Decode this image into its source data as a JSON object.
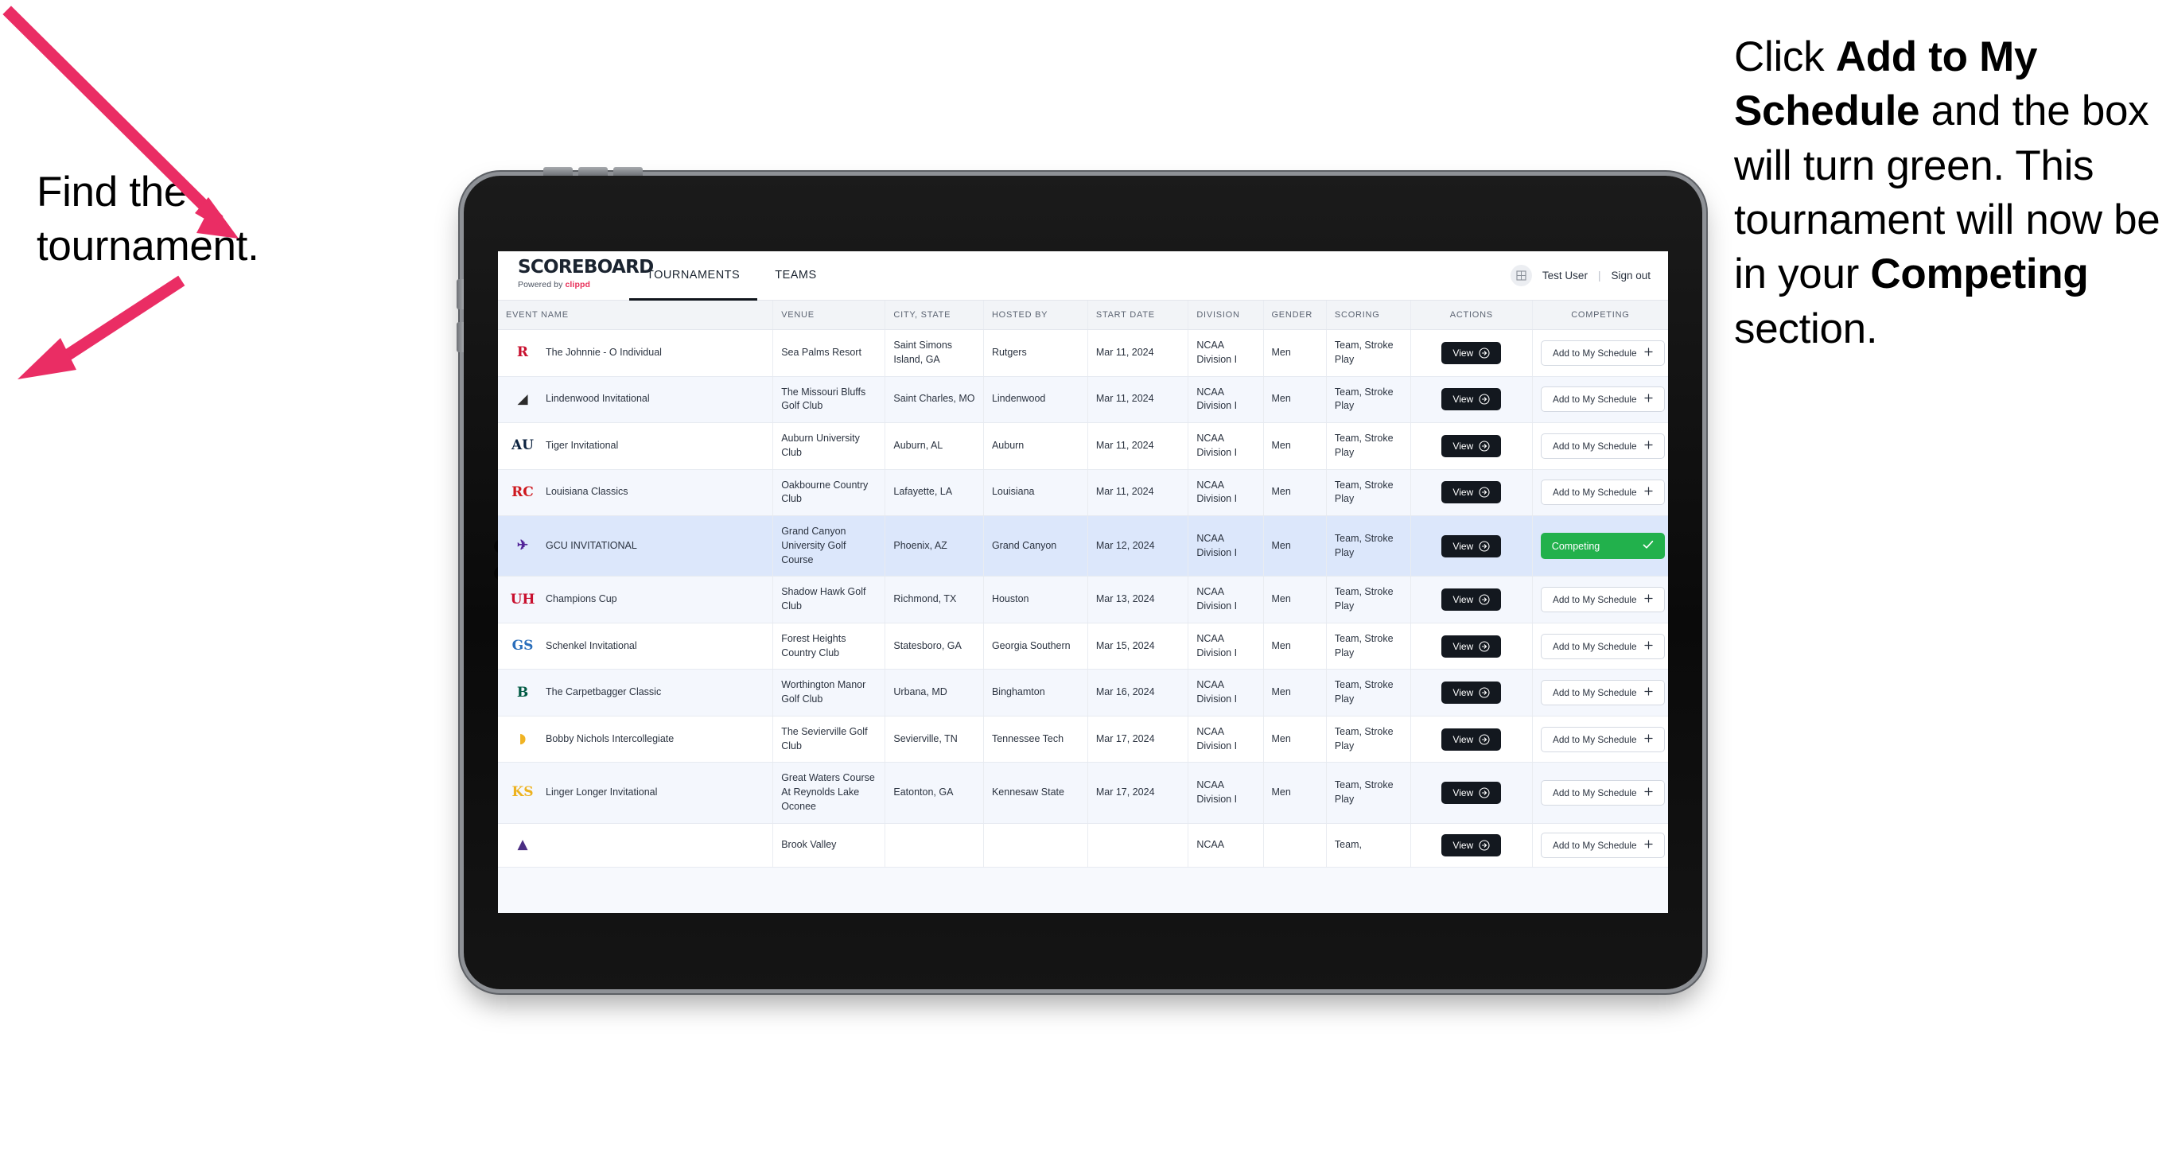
{
  "annotations": {
    "left": {
      "line1": "Find the",
      "line2": "tournament."
    },
    "right": {
      "seg1": "Click ",
      "bold1": "Add to My Schedule",
      "seg2": " and the box will turn green. This tournament will now be in your ",
      "bold2": "Competing",
      "seg3": " section."
    },
    "arrow_color": "#ea2d64"
  },
  "app": {
    "brand": {
      "title": "SCOREBOARD",
      "powered_prefix": "Powered by ",
      "powered_brand": "clippd"
    },
    "tabs": [
      {
        "label": "TOURNAMENTS",
        "active": true
      },
      {
        "label": "TEAMS",
        "active": false
      }
    ],
    "account": {
      "avatar_icon": "grid-icon",
      "user": "Test User",
      "divider": "|",
      "sign_out": "Sign out"
    },
    "table": {
      "columns": [
        "EVENT NAME",
        "VENUE",
        "CITY, STATE",
        "HOSTED BY",
        "START DATE",
        "DIVISION",
        "GENDER",
        "SCORING",
        "ACTIONS",
        "COMPETING"
      ],
      "view_label": "View",
      "add_label": "Add to My Schedule",
      "add_icon": "plus-icon",
      "view_icon": "arrow-circle-right-icon",
      "competing_label": "Competing",
      "competing_icon": "check-icon",
      "competing_color": "#22b14c",
      "rows": [
        {
          "logo": {
            "text": "R",
            "color": "#c8102e",
            "font": "serif"
          },
          "event": "The Johnnie - O Individual",
          "venue": "Sea Palms Resort",
          "city": "Saint Simons Island, GA",
          "host": "Rutgers",
          "date": "Mar 11, 2024",
          "division": "NCAA Division I",
          "gender": "Men",
          "scoring": "Team, Stroke Play",
          "competing": false,
          "selected": false
        },
        {
          "logo": {
            "text": "◢",
            "color": "#2b2b2b",
            "font": "sans"
          },
          "event": "Lindenwood Invitational",
          "venue": "The Missouri Bluffs Golf Club",
          "city": "Saint Charles, MO",
          "host": "Lindenwood",
          "date": "Mar 11, 2024",
          "division": "NCAA Division I",
          "gender": "Men",
          "scoring": "Team, Stroke Play",
          "competing": false,
          "selected": false
        },
        {
          "logo": {
            "text": "AU",
            "color": "#0c2340",
            "font": "serif"
          },
          "event": "Tiger Invitational",
          "venue": "Auburn University Club",
          "city": "Auburn, AL",
          "host": "Auburn",
          "date": "Mar 11, 2024",
          "division": "NCAA Division I",
          "gender": "Men",
          "scoring": "Team, Stroke Play",
          "competing": false,
          "selected": false
        },
        {
          "logo": {
            "text": "RC",
            "color": "#ce181e",
            "font": "sans"
          },
          "event": "Louisiana Classics",
          "venue": "Oakbourne Country Club",
          "city": "Lafayette, LA",
          "host": "Louisiana",
          "date": "Mar 11, 2024",
          "division": "NCAA Division I",
          "gender": "Men",
          "scoring": "Team, Stroke Play",
          "competing": false,
          "selected": false
        },
        {
          "logo": {
            "text": "✈",
            "color": "#522398",
            "font": "sans"
          },
          "event": "GCU INVITATIONAL",
          "venue": "Grand Canyon University Golf Course",
          "city": "Phoenix, AZ",
          "host": "Grand Canyon",
          "date": "Mar 12, 2024",
          "division": "NCAA Division I",
          "gender": "Men",
          "scoring": "Team, Stroke Play",
          "competing": true,
          "selected": true
        },
        {
          "logo": {
            "text": "UH",
            "color": "#c8102e",
            "font": "serif"
          },
          "event": "Champions Cup",
          "venue": "Shadow Hawk Golf Club",
          "city": "Richmond, TX",
          "host": "Houston",
          "date": "Mar 13, 2024",
          "division": "NCAA Division I",
          "gender": "Men",
          "scoring": "Team, Stroke Play",
          "competing": false,
          "selected": false
        },
        {
          "logo": {
            "text": "GS",
            "color": "#2a6ebb",
            "font": "sans"
          },
          "event": "Schenkel Invitational",
          "venue": "Forest Heights Country Club",
          "city": "Statesboro, GA",
          "host": "Georgia Southern",
          "date": "Mar 15, 2024",
          "division": "NCAA Division I",
          "gender": "Men",
          "scoring": "Team, Stroke Play",
          "competing": false,
          "selected": false
        },
        {
          "logo": {
            "text": "B",
            "color": "#005a43",
            "font": "serif"
          },
          "event": "The Carpetbagger Classic",
          "venue": "Worthington Manor Golf Club",
          "city": "Urbana, MD",
          "host": "Binghamton",
          "date": "Mar 16, 2024",
          "division": "NCAA Division I",
          "gender": "Men",
          "scoring": "Team, Stroke Play",
          "competing": false,
          "selected": false
        },
        {
          "logo": {
            "text": "◗",
            "color": "#f0b323",
            "font": "sans"
          },
          "event": "Bobby Nichols Intercollegiate",
          "venue": "The Sevierville Golf Club",
          "city": "Sevierville, TN",
          "host": "Tennessee Tech",
          "date": "Mar 17, 2024",
          "division": "NCAA Division I",
          "gender": "Men",
          "scoring": "Team, Stroke Play",
          "competing": false,
          "selected": false
        },
        {
          "logo": {
            "text": "KS",
            "color": "#edb21f",
            "font": "serif"
          },
          "event": "Linger Longer Invitational",
          "venue": "Great Waters Course At Reynolds Lake Oconee",
          "city": "Eatonton, GA",
          "host": "Kennesaw State",
          "date": "Mar 17, 2024",
          "division": "NCAA Division I",
          "gender": "Men",
          "scoring": "Team, Stroke Play",
          "competing": false,
          "selected": false
        },
        {
          "logo": {
            "text": "▲",
            "color": "#4b2e83",
            "font": "sans"
          },
          "event": "",
          "venue": "Brook Valley",
          "city": "",
          "host": "",
          "date": "",
          "division": "NCAA",
          "gender": "",
          "scoring": "Team,",
          "competing": false,
          "selected": false
        }
      ]
    }
  }
}
